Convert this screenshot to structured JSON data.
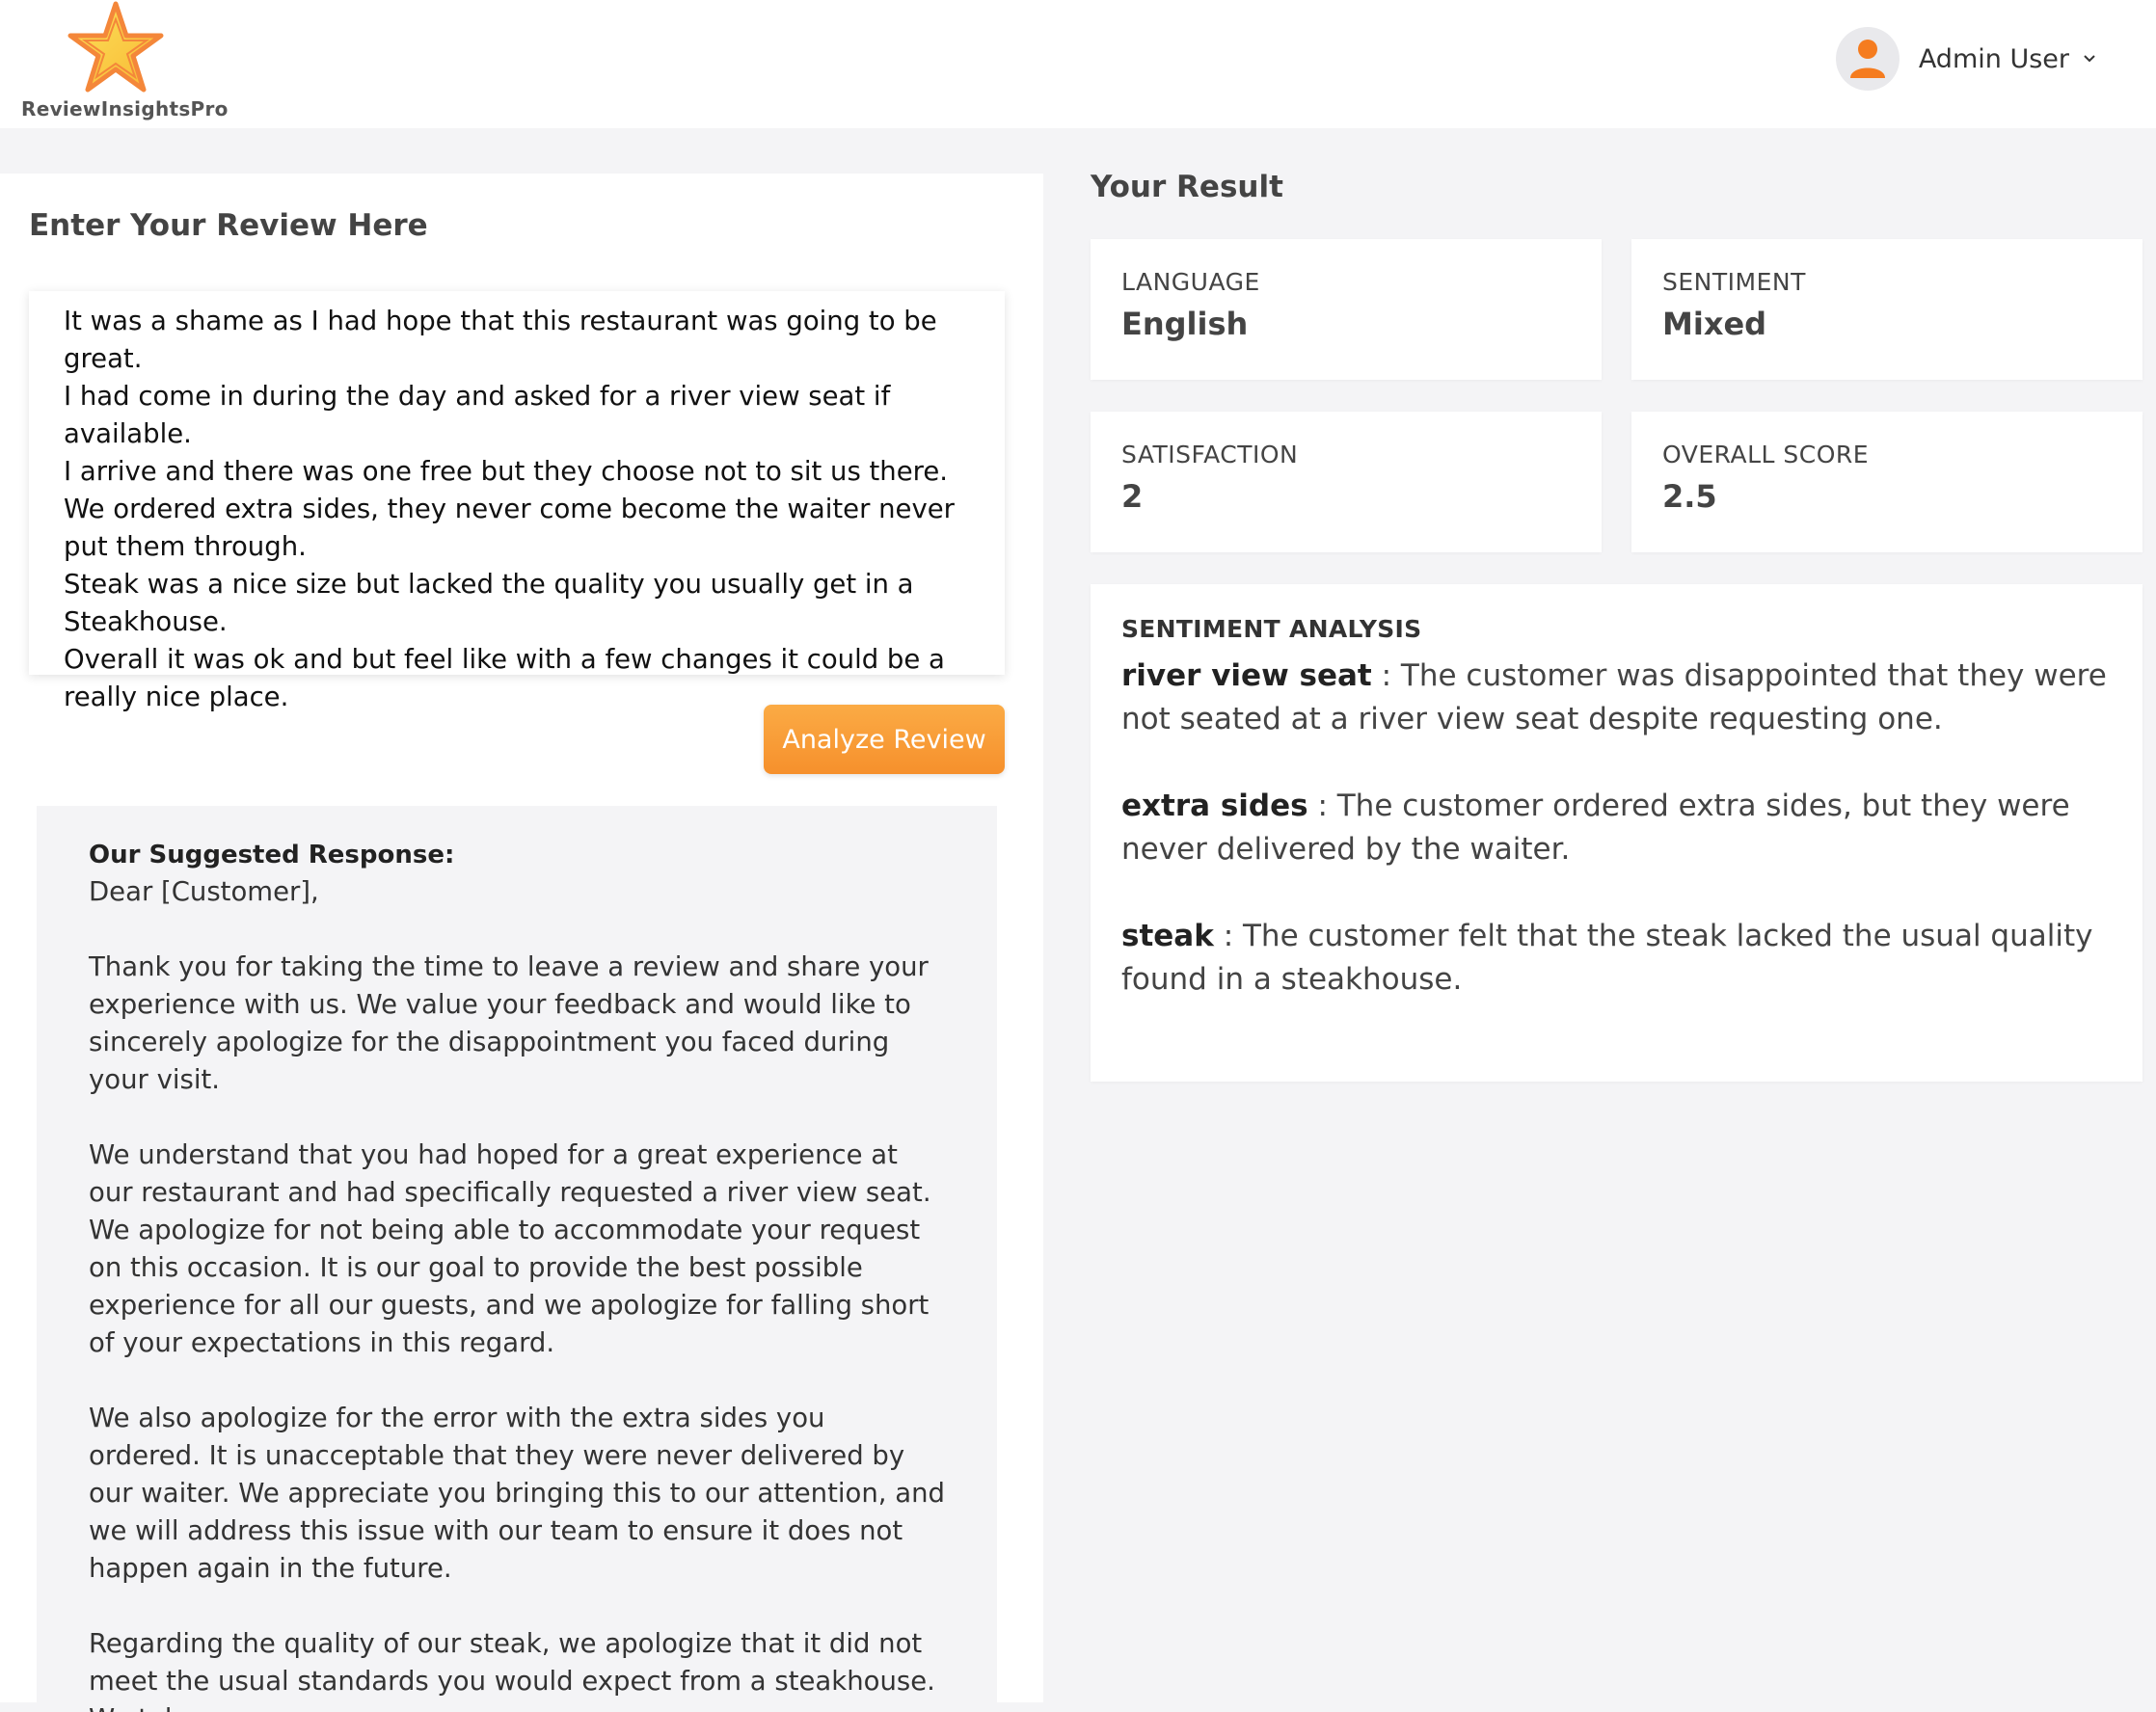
{
  "brand": {
    "name": "ReviewInsightsPro"
  },
  "user": {
    "name": "Admin User"
  },
  "left": {
    "title": "Enter Your Review Here",
    "review_text": "It was a shame as I had hope that this restaurant was going to be great.\nI had come in during the day and asked for a river view seat if available.\nI arrive and there was one free but they choose not to sit us there. We ordered extra sides, they never come become the waiter never put them through.\nSteak was a nice size but lacked the quality you usually get in a Steakhouse.\nOverall it was ok and but feel like with a few changes it could be a really nice place.",
    "analyze_label": "Analyze Review",
    "response_heading": "Our Suggested Response:",
    "response_body": "Dear [Customer],\n\nThank you for taking the time to leave a review and share your experience with us. We value your feedback and would like to sincerely apologize for the disappointment you faced during your visit.\n\nWe understand that you had hoped for a great experience at our restaurant and had specifically requested a river view seat. We apologize for not being able to accommodate your request on this occasion. It is our goal to provide the best possible experience for all our guests, and we apologize for falling short of your expectations in this regard.\n\nWe also apologize for the error with the extra sides you ordered. It is unacceptable that they were never delivered by our waiter. We appreciate you bringing this to our attention, and we will address this issue with our team to ensure it does not happen again in the future.\n\nRegarding the quality of our steak, we apologize that it did not meet the usual standards you would expect from a steakhouse. We take"
  },
  "result": {
    "title": "Your Result",
    "language": {
      "label": "LANGUAGE",
      "value": "English"
    },
    "sentiment": {
      "label": "SENTIMENT",
      "value": "Mixed"
    },
    "satisfaction": {
      "label": "SATISFACTION",
      "value": "2"
    },
    "overall": {
      "label": "OVERALL SCORE",
      "value": "2.5"
    },
    "analysis": {
      "heading": "SENTIMENT ANALYSIS",
      "items": [
        {
          "term": "river view seat",
          "text": " : The customer was disappointed that they were not seated at a river view seat despite requesting one."
        },
        {
          "term": "extra sides",
          "text": " : The customer ordered extra sides, but they were never delivered by the waiter."
        },
        {
          "term": "steak",
          "text": " : The customer felt that the steak lacked the usual quality found in a steakhouse."
        }
      ]
    }
  },
  "colors": {
    "accent": "#f6902c",
    "star_fill": "#fbd24a",
    "page_bg": "#f4f4f6"
  }
}
